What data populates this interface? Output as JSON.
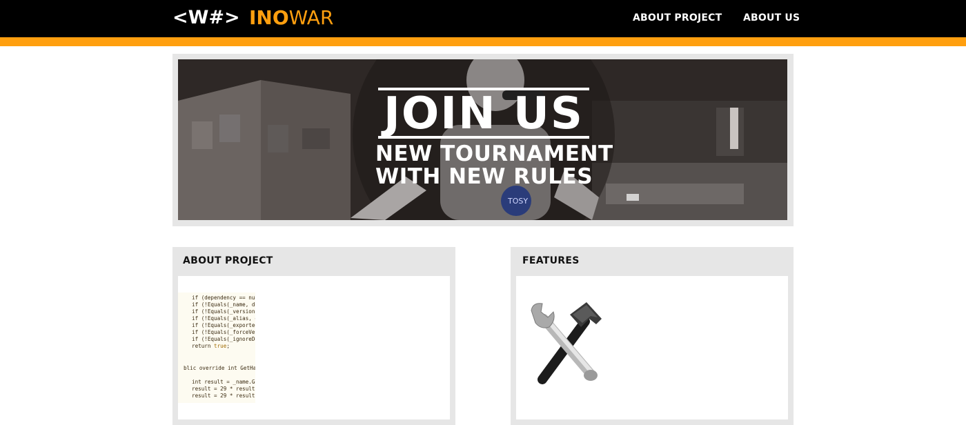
{
  "header": {
    "logo_mark": "<W#>",
    "brand_bold": "INO",
    "brand_light": "WAR",
    "nav": [
      "ABOUT PROJECT",
      "ABOUT US"
    ]
  },
  "hero": {
    "title": "JOIN US",
    "subtitle_line1": "NEW TOURNAMENT",
    "subtitle_line2": "WITH NEW RULES",
    "badge": "TOSY"
  },
  "cards": {
    "about": {
      "title": "ABOUT PROJECT",
      "code_lines": [
        "if (dependency == nul",
        "if (!Equals(_name, de",
        "if (!Equals(_version,",
        "if (!Equals(_alias, d",
        "if (!Equals(_exported",
        "if (!Equals(_forceVer",
        "if (!Equals(_ignoreDe",
        "return true;",
        "blic override int GetHa",
        "int result = _name.Ge",
        "result = 29 * result",
        "result = 29 * result"
      ]
    },
    "features": {
      "title": "FEATURES",
      "icon": "wrench-hammer-icon"
    }
  },
  "colors": {
    "accent": "#ff9f0f",
    "topbar": "#000000",
    "card_bg": "#e6e6e6"
  }
}
